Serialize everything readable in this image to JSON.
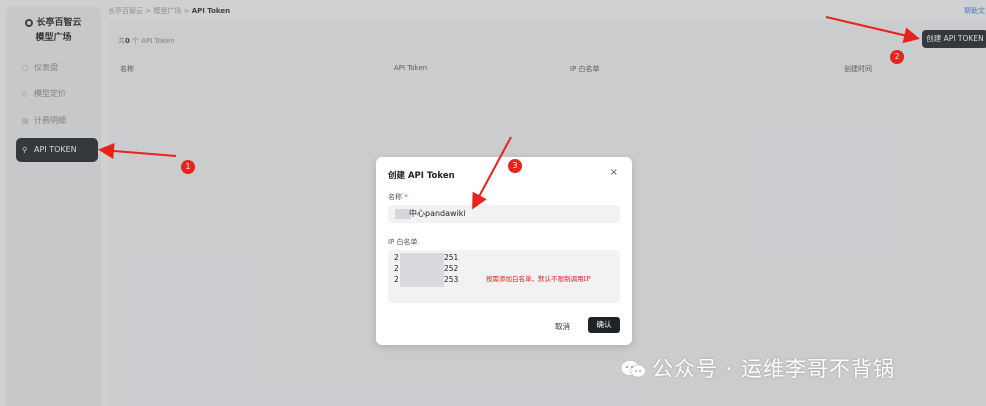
{
  "sidebar": {
    "brand_line1": "长亭百智云",
    "brand_line2": "模型广场",
    "items": [
      {
        "label": "仪表盘",
        "icon": "dashboard-icon"
      },
      {
        "label": "模型定价",
        "icon": "pricing-icon"
      },
      {
        "label": "计费明细",
        "icon": "billing-icon"
      },
      {
        "label": "API TOKEN",
        "icon": "key-icon",
        "active": true
      }
    ]
  },
  "breadcrumb": {
    "part1": "长亭百智云",
    "sep": ">",
    "part2": "模型广场",
    "current": "API Token"
  },
  "header": {
    "help_link": "帮助文",
    "count_prefix": "共",
    "count": "0",
    "count_suffix": "个 API Token",
    "create_button": "创建 API TOKEN"
  },
  "table": {
    "columns": [
      "名称",
      "API Token",
      "IP 白名单",
      "创建时间"
    ]
  },
  "modal": {
    "title": "创建 API Token",
    "close": "×",
    "name_label": "名称",
    "required_mark": "*",
    "name_value": "中心pandawiki",
    "ip_label": "IP 白名单",
    "ip_lines": [
      "2",
      "2",
      "2"
    ],
    "ip_suffixes": [
      "251",
      "252",
      "253"
    ],
    "ip_hint": "按需添加白名单，默认不限制调用IP",
    "cancel_button": "取消",
    "confirm_button": "确认"
  },
  "annotations": {
    "badges": [
      "1",
      "2",
      "3"
    ],
    "color": "#e8231b"
  },
  "watermark": {
    "text": "公众号 · 运维李哥不背锅"
  }
}
